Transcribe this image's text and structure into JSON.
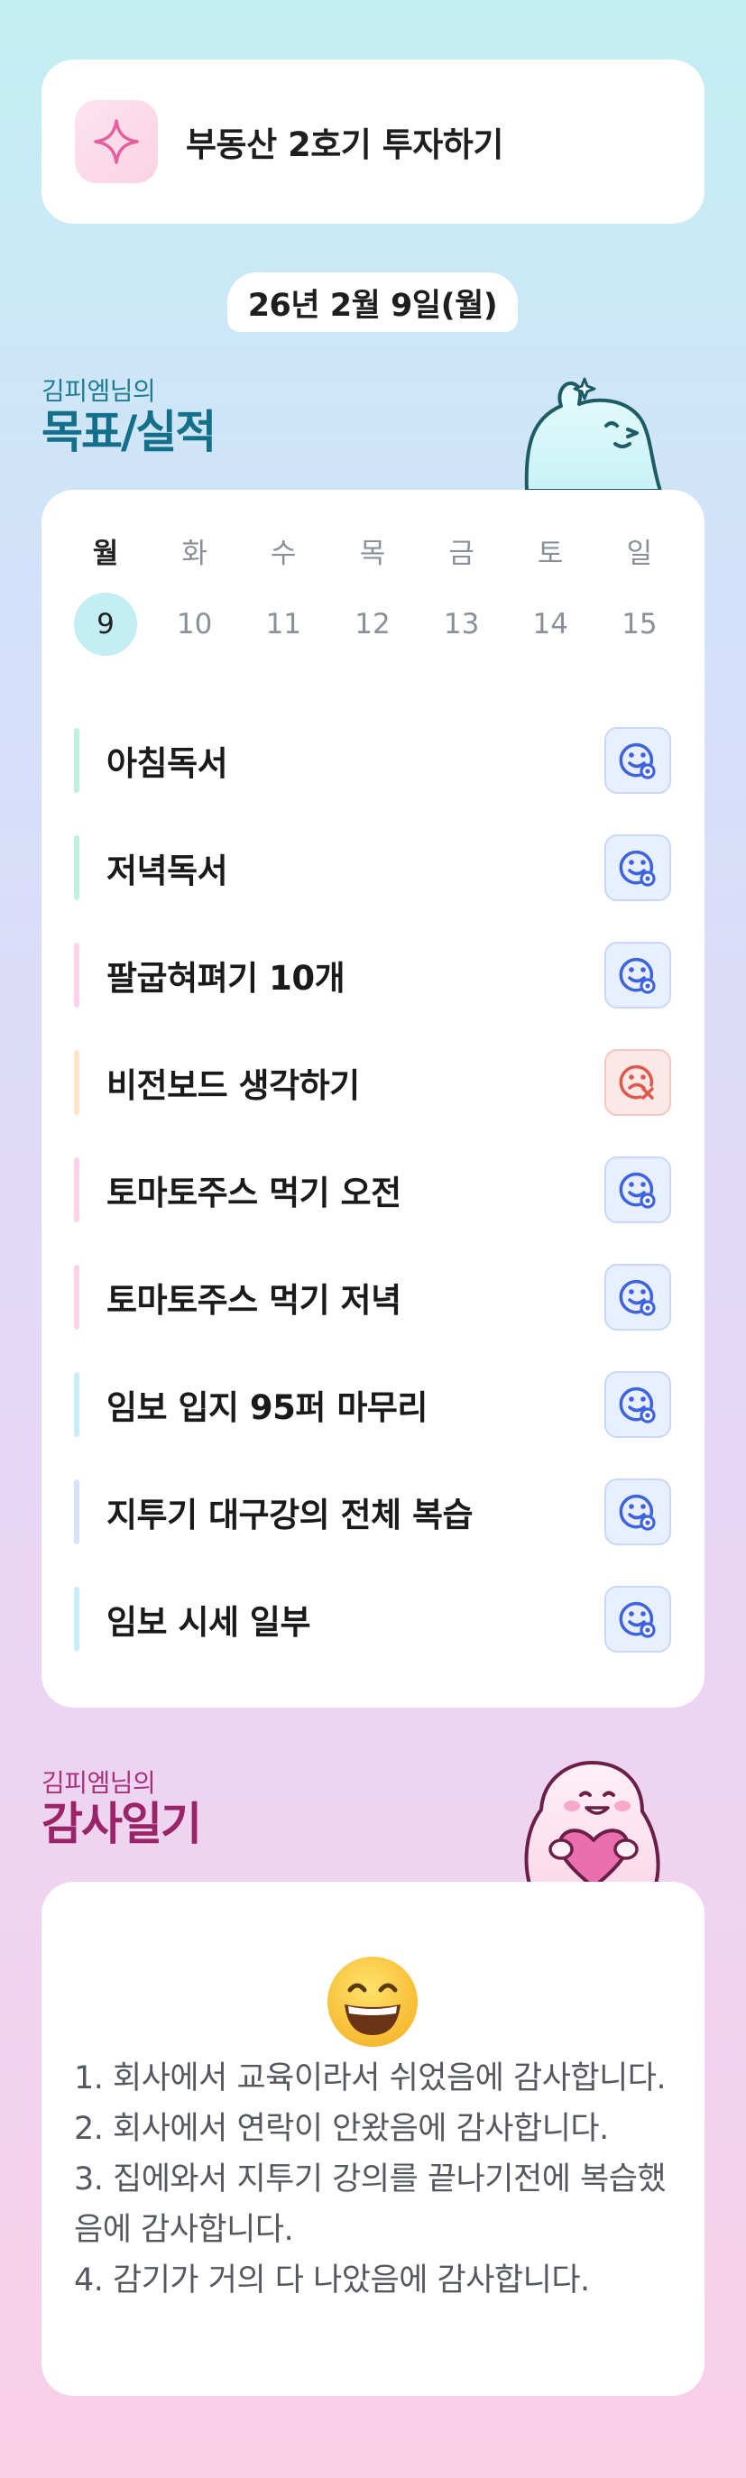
{
  "goal": {
    "icon": "sparkle-icon",
    "text": "부동산 2호기 투자하기"
  },
  "date": "26년 2월 9일(월)",
  "goals_section": {
    "subtitle": "김피엠님의",
    "title": "목표/실적",
    "mascot": "waving-ghost-mascot"
  },
  "week": [
    {
      "name": "월",
      "num": "9",
      "selected": true
    },
    {
      "name": "화",
      "num": "10"
    },
    {
      "name": "수",
      "num": "11"
    },
    {
      "name": "목",
      "num": "12"
    },
    {
      "name": "금",
      "num": "13"
    },
    {
      "name": "토",
      "num": "14"
    },
    {
      "name": "일",
      "num": "15"
    }
  ],
  "tasks": [
    {
      "label": "아침독서",
      "color": "#bff0e0",
      "status": "done"
    },
    {
      "label": "저녁독서",
      "color": "#bff0e0",
      "status": "done"
    },
    {
      "label": "팔굽혀펴기 10개",
      "color": "#fcd3e9",
      "status": "done"
    },
    {
      "label": "비전보드 생각하기",
      "color": "#fde3c8",
      "status": "failed"
    },
    {
      "label": "토마토주스 먹기 오전",
      "color": "#fcd3e9",
      "status": "done"
    },
    {
      "label": "토마토주스 먹기 저녁",
      "color": "#fcd3e9",
      "status": "done"
    },
    {
      "label": "임보 입지 95퍼 마무리",
      "color": "#c9eff4",
      "status": "done"
    },
    {
      "label": "지투기 대구강의 전체 복습",
      "color": "#d7e1fb",
      "status": "done"
    },
    {
      "label": "임보 시세 일부",
      "color": "#c9eff4",
      "status": "done"
    }
  ],
  "thanks_section": {
    "subtitle": "김피엠님의",
    "title": "감사일기",
    "mascot": "heart-ghost-mascot"
  },
  "thanks": {
    "emoji": "grinning-face-emoji",
    "text": "1. 회사에서 교육이라서 쉬었음에 감사합니다.\n2. 회사에서 연락이 안왔음에 감사합니다.\n3. 집에와서 지투기 강의를 끝나기전에 복습했음에 감사합니다.\n4. 감기가 거의 다 나았음에 감사합니다."
  },
  "colors": {
    "accent_teal": "#136f8a",
    "accent_pink": "#9b2468",
    "good": "#3d63e0",
    "bad": "#e2574c"
  }
}
